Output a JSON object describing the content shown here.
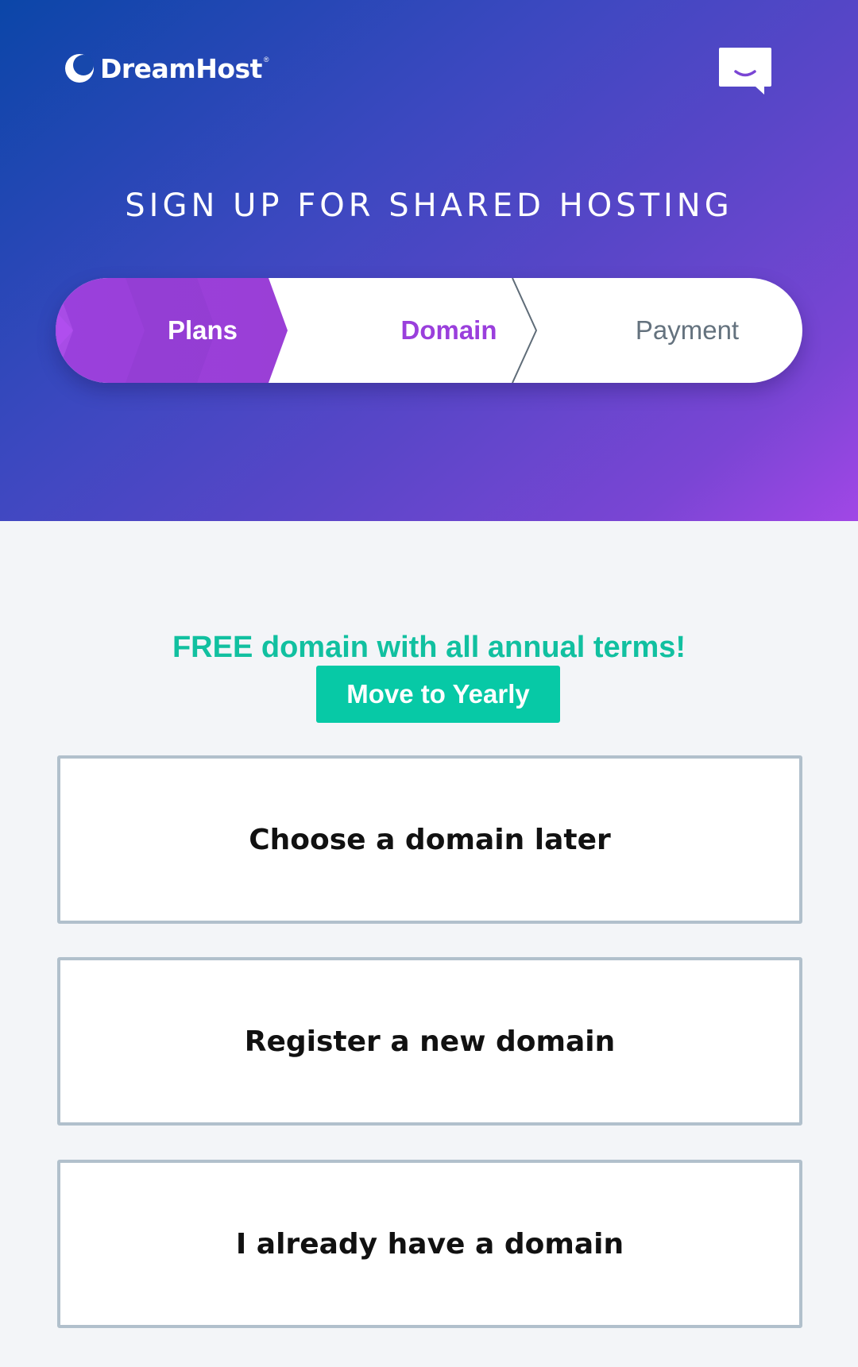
{
  "brand": {
    "name": "DreamHost",
    "registered": "®"
  },
  "header": {
    "title": "SIGN UP FOR SHARED HOSTING",
    "chat_icon": "chat-bubble-smile-icon"
  },
  "stepper": {
    "steps": [
      {
        "label": "Plans",
        "state": "completed"
      },
      {
        "label": "Domain",
        "state": "current"
      },
      {
        "label": "Payment",
        "state": "upcoming"
      }
    ]
  },
  "promo": {
    "text": "FREE domain with all annual terms!",
    "button_label": "Move to Yearly"
  },
  "options": [
    {
      "label": "Choose a domain later"
    },
    {
      "label": "Register a new domain"
    },
    {
      "label": "I already have a domain"
    }
  ],
  "colors": {
    "accent_purple": "#9a3fdc",
    "accent_teal": "#07c9a6",
    "border_gray": "#b1c0cc"
  }
}
